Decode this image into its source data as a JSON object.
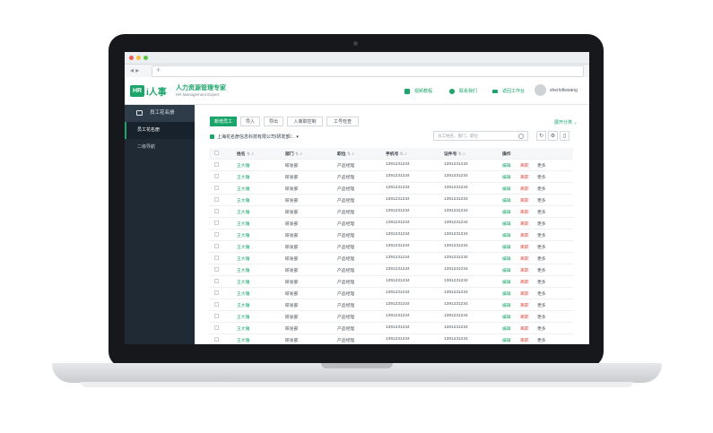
{
  "header": {
    "logo_badge": "HR",
    "logo_text": "i人事",
    "title": "人力资源管理专家",
    "subtitle": "HR Management Expert",
    "links": [
      "视频教程",
      "联系我们",
      "返回工作台"
    ],
    "username": "sherlotlewang"
  },
  "sidebar": {
    "section_title": "员工花名册",
    "items": [
      "员工花名册",
      "二级导航"
    ]
  },
  "toolbar": {
    "buttons": [
      "新增员工",
      "导入",
      "导出",
      "入离职控制",
      "工号检查"
    ],
    "column_settings": "展开分类"
  },
  "org_path": "上海花名册信息科技有限公司/研发部/...",
  "search_placeholder": "员工姓名、部门、职位",
  "table": {
    "headers": [
      "姓名",
      "部门",
      "职位",
      "手机号",
      "证件号",
      "操作"
    ],
    "row": {
      "name": "王大锤",
      "dept": "研发部",
      "position": "产品经理",
      "phone": "1391231234",
      "id_no": "1391231234",
      "edit": "编辑",
      "leave": "离职",
      "more": "更多"
    },
    "row_count": 17
  },
  "colors": {
    "accent": "#1aa56b",
    "sidebar_bg": "#1f2a35",
    "danger": "#e0463c"
  }
}
